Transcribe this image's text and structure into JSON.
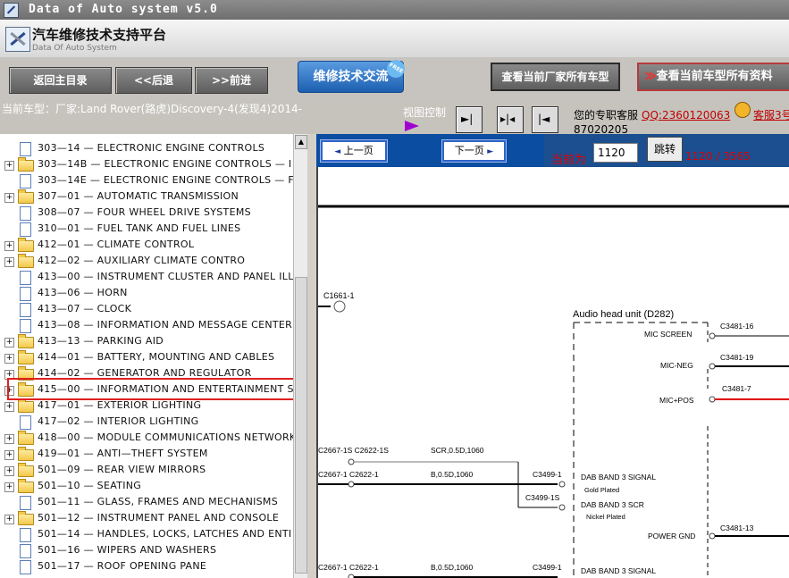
{
  "window": {
    "title": "Data of Auto system v5.0"
  },
  "header": {
    "title": "汽车维修技术支持平台",
    "subtitle": "Data Of Auto System"
  },
  "toolbar": {
    "home": "返回主目录",
    "back": "<<后退",
    "forward": ">>前进",
    "forum": "维修技术交流",
    "free_badge": "FREE",
    "all_models": "查看当前厂家所有车型",
    "all_info_arrows": "≫",
    "all_info": "查看当前车型所有资料"
  },
  "infobar": {
    "current_model": "当前车型：厂家:Land Rover(路虎)Discovery-4(发现4)2014-",
    "view_control": "视图控制",
    "support_label": "您的专职客服",
    "support_qq": "QQ:2360120063",
    "support_id": "87020205",
    "support_service": "客服3号"
  },
  "tree": {
    "items": [
      {
        "label": "303—14 — ELECTRONIC ENGINE CONTROLS",
        "type": "doc"
      },
      {
        "label": "303—14B — ELECTRONIC ENGINE CONTROLS — I",
        "type": "folder"
      },
      {
        "label": "303—14E — ELECTRONIC ENGINE CONTROLS — F",
        "type": "doc"
      },
      {
        "label": "307—01 — AUTOMATIC TRANSMISSION",
        "type": "folder"
      },
      {
        "label": "308—07 — FOUR WHEEL DRIVE SYSTEMS",
        "type": "doc"
      },
      {
        "label": "310—01 — FUEL TANK AND FUEL LINES",
        "type": "doc"
      },
      {
        "label": "412—01 — CLIMATE CONTROL",
        "type": "folder"
      },
      {
        "label": "412—02 — AUXILIARY CLIMATE CONTRO",
        "type": "folder"
      },
      {
        "label": "413—00 — INSTRUMENT CLUSTER AND PANEL ILL",
        "type": "doc"
      },
      {
        "label": "413—06 — HORN",
        "type": "doc"
      },
      {
        "label": "413—07 — CLOCK",
        "type": "doc"
      },
      {
        "label": "413—08 — INFORMATION AND MESSAGE CENTER",
        "type": "doc"
      },
      {
        "label": "413—13 — PARKING AID",
        "type": "folder"
      },
      {
        "label": "414—01 — BATTERY, MOUNTING AND CABLES",
        "type": "folder"
      },
      {
        "label": "414—02 — GENERATOR AND REGULATOR",
        "type": "folder"
      },
      {
        "label": "415—00 — INFORMATION AND ENTERTAINMENT S",
        "type": "folder"
      },
      {
        "label": "417—01 — EXTERIOR LIGHTING",
        "type": "folder"
      },
      {
        "label": "417—02 — INTERIOR LIGHTING",
        "type": "doc"
      },
      {
        "label": "418—00 — MODULE COMMUNICATIONS NETWORK",
        "type": "folder"
      },
      {
        "label": "419—01 — ANTI—THEFT SYSTEM",
        "type": "folder"
      },
      {
        "label": "501—09 — REAR VIEW MIRRORS",
        "type": "folder"
      },
      {
        "label": "501—10 — SEATING",
        "type": "folder"
      },
      {
        "label": "501—11 — GLASS, FRAMES AND MECHANISMS",
        "type": "doc"
      },
      {
        "label": "501—12 — INSTRUMENT PANEL AND CONSOLE",
        "type": "folder"
      },
      {
        "label": "501—14 — HANDLES, LOCKS, LATCHES AND ENTI",
        "type": "doc"
      },
      {
        "label": "501—16 — WIPERS AND WASHERS",
        "type": "doc"
      },
      {
        "label": "501—17 — ROOF OPENING PANE",
        "type": "doc"
      }
    ],
    "selected_index": 15
  },
  "viewer": {
    "prev": "上一页",
    "next": "下一页",
    "current_label": "当前为",
    "page_value": "1120",
    "jump": "跳转",
    "page_count": "1120 / 3565"
  },
  "diagram": {
    "unit_title": "Audio head unit (D282)",
    "connector_c1661": "C1661-1",
    "pins": [
      {
        "name": "MIC SCREEN",
        "conn": "C3481-16"
      },
      {
        "name": "MIC-NEG",
        "conn": "C3481-19"
      },
      {
        "name": "MIC+POS",
        "conn": "C3481-7"
      },
      {
        "name": "DAB BAND 3 SIGNAL",
        "sub": "Gold Plated",
        "conn": "C3499-1"
      },
      {
        "name": "DAB BAND 3 SCR",
        "sub": "Nickel Plated",
        "conn": "C3499-1S"
      },
      {
        "name": "POWER GND",
        "conn": "C3481-13"
      },
      {
        "name": "DAB BAND 3 SIGNAL",
        "conn": "C3499-1"
      }
    ],
    "wires": [
      {
        "from": "C2667-1S C2622-1S",
        "spec": "SCR,0.5D,1060"
      },
      {
        "from": "C2667-1 C2622-1",
        "spec": "B,0.5D,1060"
      },
      {
        "from": "C2667-1 C2622-1",
        "spec": "B,0.5D,1060"
      }
    ],
    "colors": {
      "mic_pos_wire": "#e00000",
      "viewer_bar": "#1b4f8f",
      "page_text": "#e00000"
    }
  }
}
